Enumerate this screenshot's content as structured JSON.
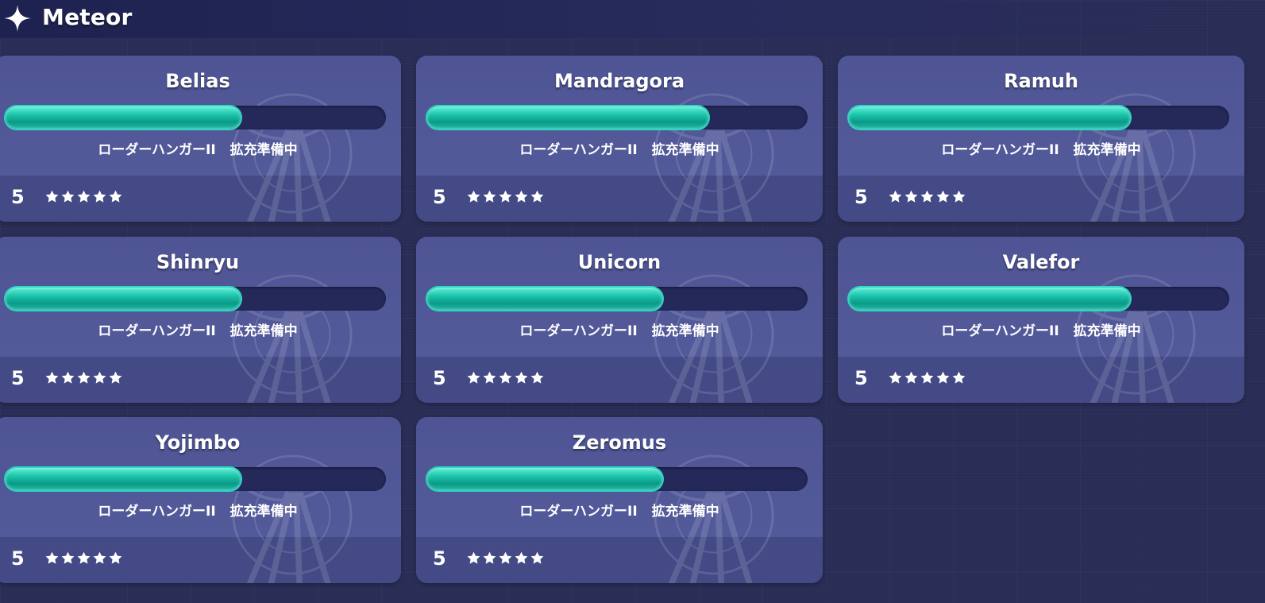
{
  "header": {
    "title": "Meteor",
    "icon": "sparkle-icon"
  },
  "colors": {
    "background": "#2b2e57",
    "card": "#4f5595",
    "card_footer": "#434a86",
    "bar_track": "#25295a",
    "bar_fill": "#1fc7ad"
  },
  "cards": [
    {
      "name": "Belias",
      "progress": 0.62,
      "status_a": "ローダーハンガーII",
      "status_b": "拡充準備中",
      "level": "5",
      "stars": 5
    },
    {
      "name": "Mandragora",
      "progress": 0.74,
      "status_a": "ローダーハンガーII",
      "status_b": "拡充準備中",
      "level": "5",
      "stars": 5
    },
    {
      "name": "Ramuh",
      "progress": 0.74,
      "status_a": "ローダーハンガーII",
      "status_b": "拡充準備中",
      "level": "5",
      "stars": 5
    },
    {
      "name": "Shinryu",
      "progress": 0.62,
      "status_a": "ローダーハンガーII",
      "status_b": "拡充準備中",
      "level": "5",
      "stars": 5
    },
    {
      "name": "Unicorn",
      "progress": 0.62,
      "status_a": "ローダーハンガーII",
      "status_b": "拡充準備中",
      "level": "5",
      "stars": 5
    },
    {
      "name": "Valefor",
      "progress": 0.74,
      "status_a": "ローダーハンガーII",
      "status_b": "拡充準備中",
      "level": "5",
      "stars": 5
    },
    {
      "name": "Yojimbo",
      "progress": 0.62,
      "status_a": "ローダーハンガーII",
      "status_b": "拡充準備中",
      "level": "5",
      "stars": 5
    },
    {
      "name": "Zeromus",
      "progress": 0.62,
      "status_a": "ローダーハンガーII",
      "status_b": "拡充準備中",
      "level": "5",
      "stars": 5
    }
  ]
}
